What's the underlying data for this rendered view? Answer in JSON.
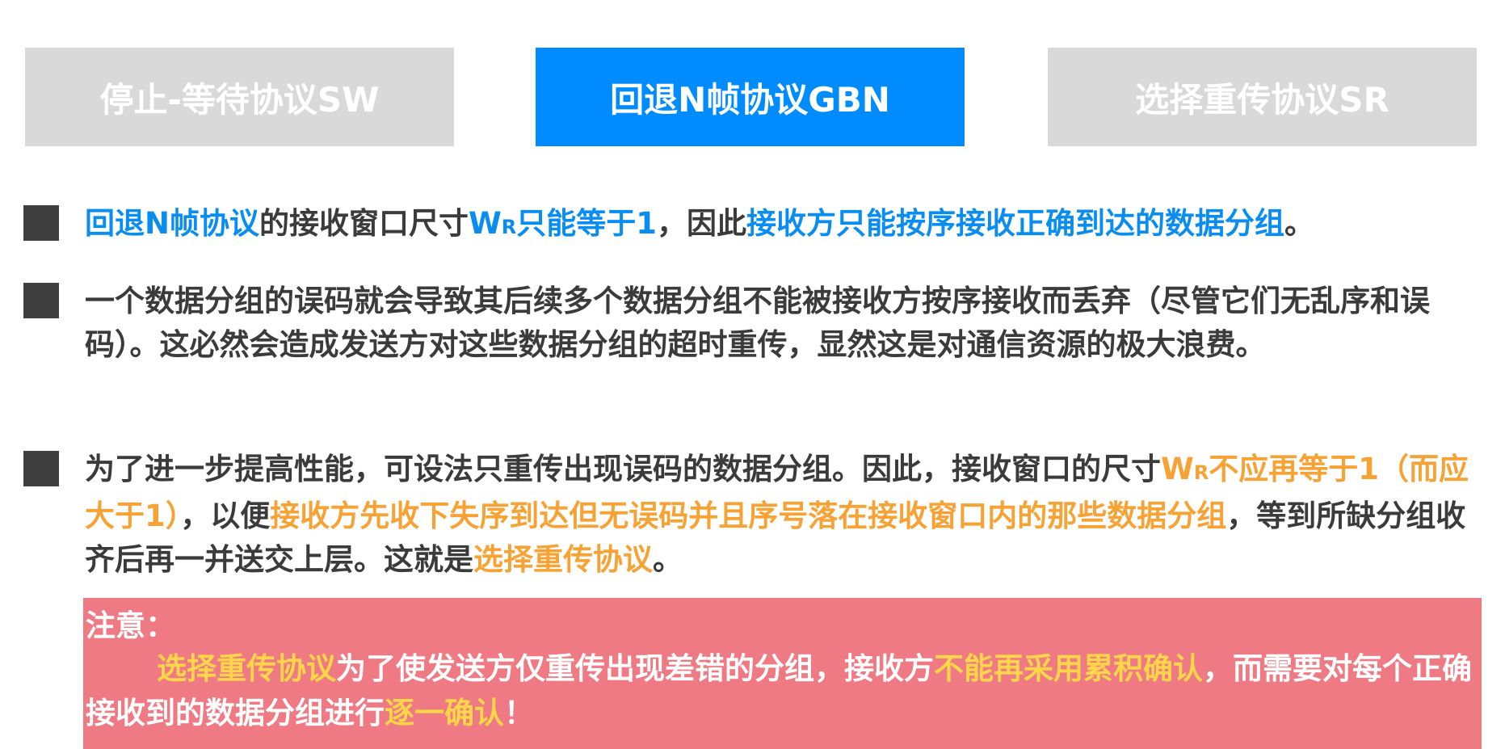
{
  "tabs": {
    "sw": "停止-等待协议SW",
    "gbn": "回退N帧协议GBN",
    "sr": "选择重传协议SR"
  },
  "p1": {
    "a": "回退N帧协议",
    "b": "的接收窗口尺寸",
    "c": "W",
    "c_sub": "R",
    "d": "只能等于1",
    "e": "，因此",
    "f": "接收方只能按序接收正确到达的数据分组",
    "g": "。"
  },
  "p2": {
    "text": "一个数据分组的误码就会导致其后续多个数据分组不能被接收方按序接收而丢弃（尽管它们无乱序和误码）。这必然会造成发送方对这些数据分组的超时重传，显然这是对通信资源的极大浪费。"
  },
  "p3": {
    "a": "为了进一步提高性能，可设法只重传出现误码的数据分组。因此，接收窗口的尺寸",
    "b": "W",
    "b_sub": "R",
    "c": "不应再等于1（而应大于1）",
    "d": "，以便",
    "e": "接收方先收下失序到达但无误码并且序号落在接收窗口内的那些数据分组",
    "f": "，等到所缺分组收齐后再一并送交上层。这就是",
    "g": "选择重传协议",
    "h": "。"
  },
  "note": {
    "title": "注意：",
    "a": "选择重传协议",
    "b": "为了使发送方仅重传出现差错的分组，接收方",
    "c": "不能再采用累积确认",
    "d": "，而需要对每个正确接收到的数据分组进行",
    "e": "逐一确认",
    "f": "！"
  },
  "colors": {
    "tab_active": "#008cff",
    "tab_inactive": "#d9d9d9",
    "highlight_blue": "#0a8df0",
    "highlight_orange": "#f7a234",
    "note_background": "#f07a83",
    "note_highlight": "#ffd54a"
  }
}
